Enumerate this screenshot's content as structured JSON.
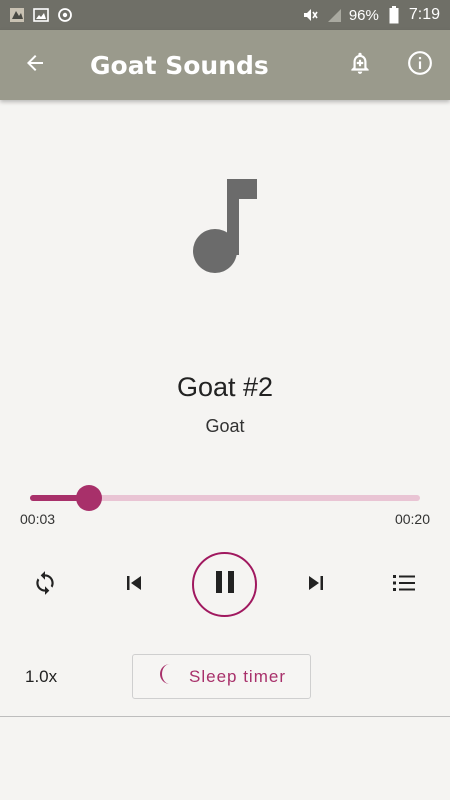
{
  "status_bar": {
    "battery": "96%",
    "time": "7:19",
    "icons": [
      "notification-app-icon",
      "image-icon",
      "sync-icon",
      "mute-icon",
      "signal-icon",
      "battery-icon"
    ]
  },
  "app_bar": {
    "title": "Goat Sounds",
    "back_icon": "arrow-back-icon",
    "actions": [
      "add-alarm-icon",
      "info-icon"
    ]
  },
  "track": {
    "title": "Goat #2",
    "subtitle": "Goat",
    "artwork_icon": "music-note-icon"
  },
  "playback": {
    "elapsed": "00:03",
    "duration": "00:20",
    "progress": 0.15,
    "state": "playing"
  },
  "controls": {
    "icons": [
      "repeat-icon",
      "skip-previous-icon",
      "pause-icon",
      "skip-next-icon",
      "playlist-icon"
    ]
  },
  "speed": "1.0x",
  "sleep_timer": {
    "label": "Sleep timer",
    "icon": "moon-icon"
  },
  "colors": {
    "accent": "#a8306a",
    "app_bar": "#9a9a8c",
    "status_bar": "#6f6f67",
    "track_remaining": "#e9c4d4"
  }
}
